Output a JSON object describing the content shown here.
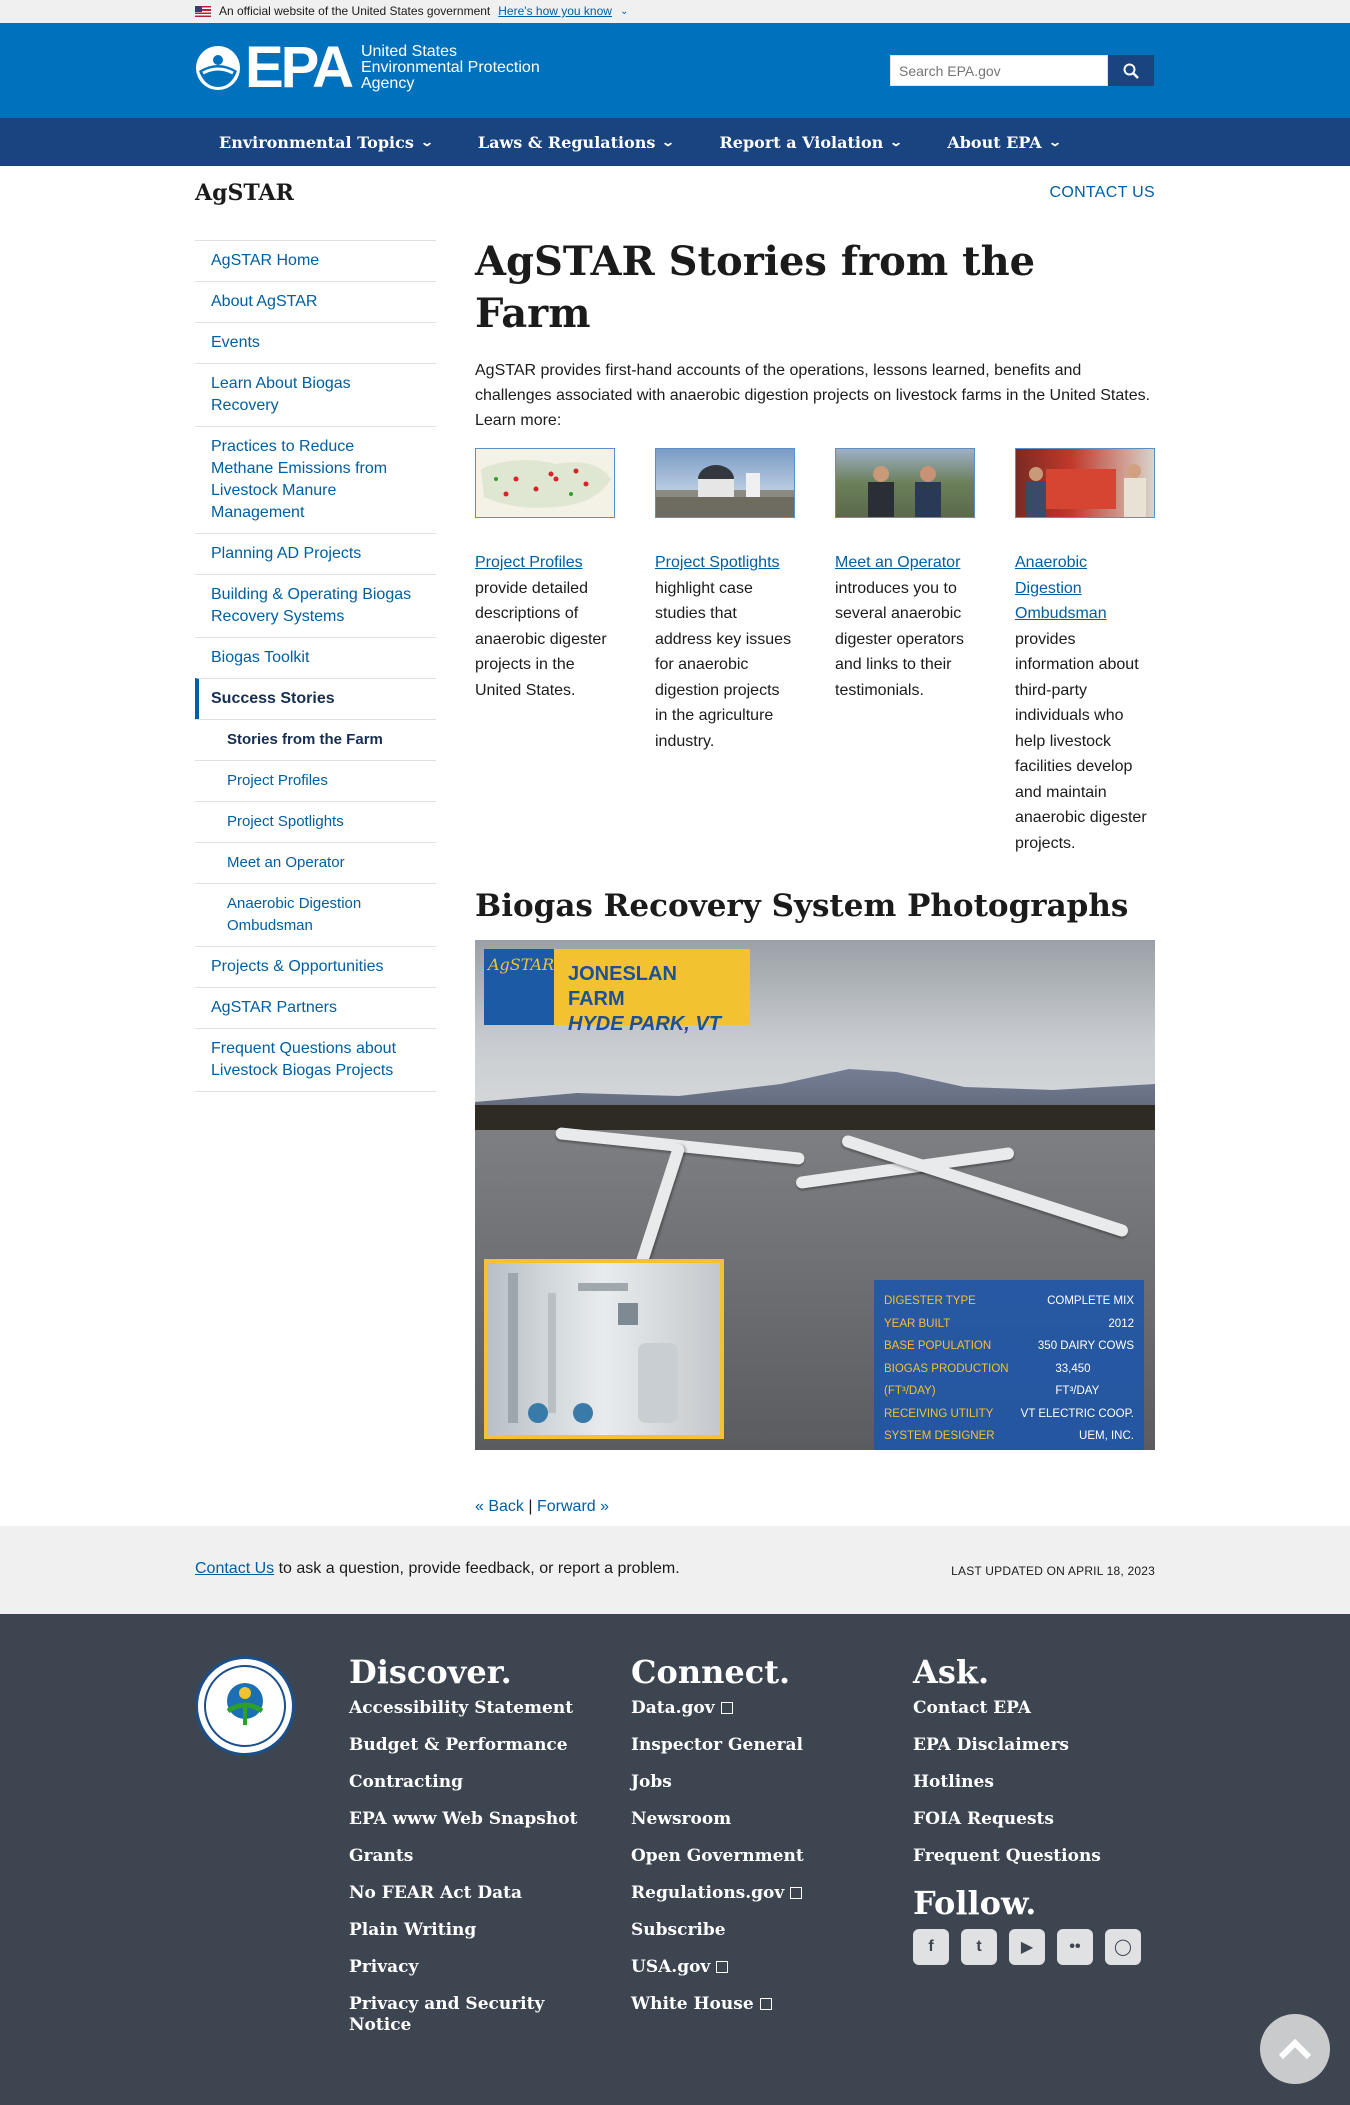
{
  "gov_banner": {
    "text": "An official website of the United States government",
    "link": "Here's how you know",
    "chevron": "chevron-down-icon"
  },
  "header": {
    "logo_text": "EPA",
    "logo_sub": [
      "United States",
      "Environmental Protection",
      "Agency"
    ],
    "search_placeholder": "Search EPA.gov"
  },
  "nav": [
    "Environmental Topics",
    "Laws & Regulations",
    "Report a Violation",
    "About EPA"
  ],
  "page": {
    "site_title": "AgSTAR",
    "contact_link": "CONTACT US"
  },
  "sidebar": {
    "items": [
      "AgSTAR Home",
      "About AgSTAR",
      "Events",
      "Learn About Biogas Recovery",
      "Practices to Reduce Methane Emissions from Livestock Manure Management",
      "Planning AD Projects",
      "Building & Operating Biogas Recovery Systems",
      "Biogas Toolkit"
    ],
    "active": "Success Stories",
    "sub": [
      "Stories from the Farm",
      "Project Profiles",
      "Project Spotlights",
      "Meet an Operator",
      "Anaerobic Digestion Ombudsman"
    ],
    "after": [
      "Projects & Opportunities",
      "AgSTAR Partners",
      "Frequent Questions about Livestock Biogas Projects"
    ]
  },
  "main": {
    "title": "AgSTAR Stories from the Farm",
    "intro": "AgSTAR provides first-hand accounts of the operations, lessons learned, benefits and challenges associated with anaerobic digestion projects on livestock farms in the United States. Learn more:",
    "cards": [
      {
        "link": "Project Profiles",
        "text": "provide detailed descriptions of anaerobic digester projects in the United States."
      },
      {
        "link": "Project Spotlights",
        "text": "highlight case studies that address key issues for anaerobic digestion projects in the agriculture industry."
      },
      {
        "link": "Meet an Operator",
        "text": "introduces you to several anaerobic digester operators and links to their testimonials."
      },
      {
        "link": "Anaerobic Digestion Ombudsman",
        "text": "provides information about third-party individuals who help livestock facilities develop and maintain anaerobic digester projects."
      }
    ],
    "h2": "Biogas Recovery System Photographs",
    "photo": {
      "badge": "AgSTAR",
      "farm": "JONESLAN FARM",
      "location": "HYDE PARK, VT",
      "stats": [
        {
          "k": "DIGESTER TYPE",
          "v": "COMPLETE MIX"
        },
        {
          "k": "YEAR BUILT",
          "v": "2012"
        },
        {
          "k": "BASE POPULATION",
          "v": "350 DAIRY COWS"
        },
        {
          "k": "BIOGAS PRODUCTION (FT³/DAY)",
          "v": "33,450 FT³/DAY"
        },
        {
          "k": "RECEIVING UTILITY",
          "v": "VT ELECTRIC COOP."
        },
        {
          "k": "SYSTEM DESIGNER",
          "v": "UEM, INC."
        }
      ]
    },
    "back": "« Back",
    "sep": "|",
    "forward": "Forward »"
  },
  "band": {
    "link": "Contact Us",
    "text": " to ask a question, provide feedback, or report a problem.",
    "updated": "LAST UPDATED ON APRIL 18, 2023"
  },
  "footer": {
    "discover": {
      "title": "Discover.",
      "links": [
        "Accessibility Statement",
        "Budget & Performance",
        "Contracting",
        "EPA www Web Snapshot",
        "Grants",
        "No FEAR Act Data",
        "Plain Writing",
        "Privacy",
        "Privacy and Security Notice"
      ]
    },
    "connect": {
      "title": "Connect.",
      "links": [
        "Data.gov",
        "Inspector General",
        "Jobs",
        "Newsroom",
        "Open Government",
        "Regulations.gov",
        "Subscribe",
        "USA.gov",
        "White House"
      ],
      "external": [
        "Data.gov",
        "Regulations.gov",
        "USA.gov",
        "White House"
      ]
    },
    "ask": {
      "title": "Ask.",
      "links": [
        "Contact EPA",
        "EPA Disclaimers",
        "Hotlines",
        "FOIA Requests",
        "Frequent Questions"
      ]
    },
    "follow": {
      "title": "Follow.",
      "icons": [
        "facebook-icon",
        "twitter-icon",
        "youtube-icon",
        "flickr-icon",
        "instagram-icon"
      ]
    }
  }
}
